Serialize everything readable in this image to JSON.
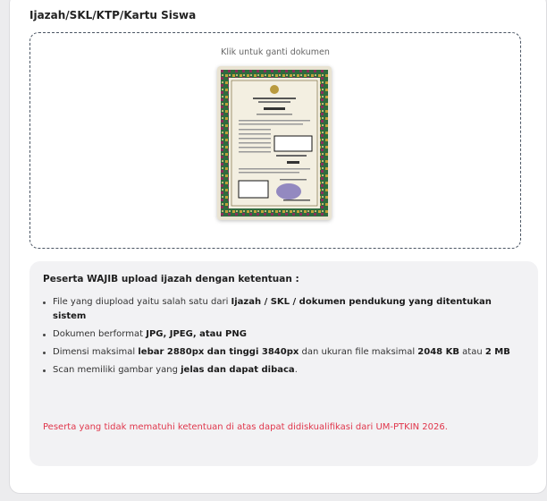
{
  "section": {
    "title": "Ijazah/SKL/KTP/Kartu Siswa"
  },
  "upload": {
    "hint": "Klik untuk ganti dokumen",
    "preview_icon": "document-image-icon",
    "colors": {
      "border": "#4a5563"
    }
  },
  "rules": {
    "title": "Peserta WAJIB upload ijazah dengan ketentuan :",
    "items": [
      {
        "a": "File yang diupload yaitu salah satu dari ",
        "b": "Ijazah / SKL / dokumen pendukung yang ditentukan sistem",
        "c": "",
        "d": "",
        "e": "",
        "f": ""
      },
      {
        "a": "Dokumen berformat ",
        "b": "JPG, JPEG, atau PNG",
        "c": "",
        "d": "",
        "e": "",
        "f": ""
      },
      {
        "a": "Dimensi maksimal ",
        "b": "lebar 2880px dan tinggi 3840px",
        "c": " dan ukuran file maksimal ",
        "d": "2048 KB",
        "e": " atau ",
        "f": "2 MB"
      },
      {
        "a": "Scan memiliki gambar yang ",
        "b": "jelas dan dapat dibaca",
        "c": ".",
        "d": "",
        "e": "",
        "f": ""
      }
    ],
    "warning": "Peserta yang tidak mematuhi ketentuan di atas dapat didiskualifikasi dari UM-PTKIN 2026.",
    "colors": {
      "warning": "#e0364b",
      "panel_bg": "#f2f2f4"
    }
  }
}
